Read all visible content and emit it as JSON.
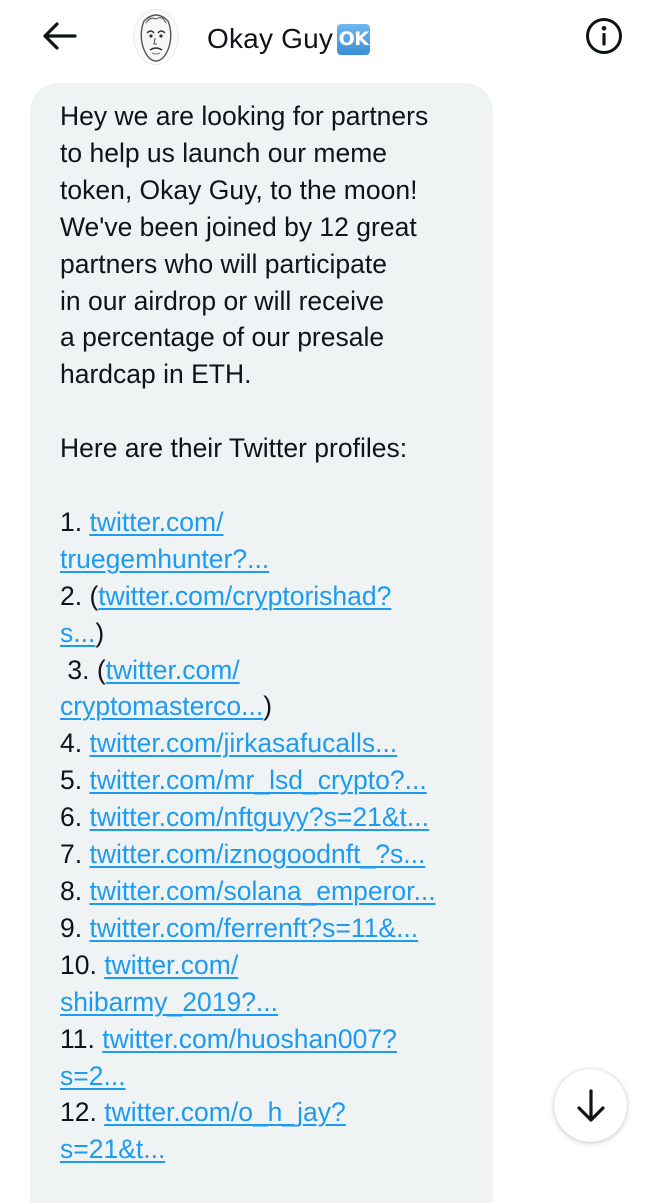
{
  "header": {
    "back_icon": "arrow-left-icon",
    "avatar_icon": "okay-guy-face",
    "name": "Okay Guy",
    "badge": "OK",
    "info_icon": "info-circle-icon"
  },
  "message": {
    "intro": [
      "Hey we are looking for partners",
      "to help us launch our meme",
      "token, Okay Guy, to the moon!",
      "We've been joined by 12 great",
      "partners who will participate",
      "in our airdrop or will receive",
      "a percentage of our presale",
      "hardcap in ETH."
    ],
    "profiles_heading": "Here are their Twitter profiles:",
    "items": [
      {
        "prefix": "1. ",
        "link1": "twitter.com/",
        "link2": "truegemhunter?...",
        "suffix": ""
      },
      {
        "prefix": "2. (",
        "link1": "twitter.com/cryptorishad?",
        "link2": "s...",
        "suffix": ")"
      },
      {
        "prefix": " 3. (",
        "link1": "twitter.com/",
        "link2": "cryptomasterco...",
        "suffix": ")"
      },
      {
        "prefix": "4. ",
        "link1": "twitter.com/jirkasafucalls...",
        "suffix": ""
      },
      {
        "prefix": "5. ",
        "link1": "twitter.com/mr_lsd_crypto?...",
        "suffix": ""
      },
      {
        "prefix": "6. ",
        "link1": "twitter.com/nftguyy?s=21&t...",
        "suffix": ""
      },
      {
        "prefix": "7. ",
        "link1": "twitter.com/iznogoodnft_?s...",
        "suffix": ""
      },
      {
        "prefix": "8. ",
        "link1": "twitter.com/solana_emperor...",
        "suffix": ""
      },
      {
        "prefix": "9. ",
        "link1": "twitter.com/ferrenft?s=11&...",
        "suffix": ""
      },
      {
        "prefix": "10. ",
        "link1": "twitter.com/",
        "link2": "shibarmy_2019?...",
        "suffix": ""
      },
      {
        "prefix": "11. ",
        "link1": "twitter.com/huoshan007?",
        "link2": "s=2...",
        "suffix": ""
      },
      {
        "prefix": "12. ",
        "link1": "twitter.com/o_h_jay?",
        "link2": "s=21&t...",
        "suffix": ""
      }
    ]
  },
  "scroll_button": {
    "icon": "arrow-down-icon"
  },
  "colors": {
    "link": "#1d9bf0",
    "bubble_bg": "#eff3f4",
    "text": "#0f1419"
  }
}
